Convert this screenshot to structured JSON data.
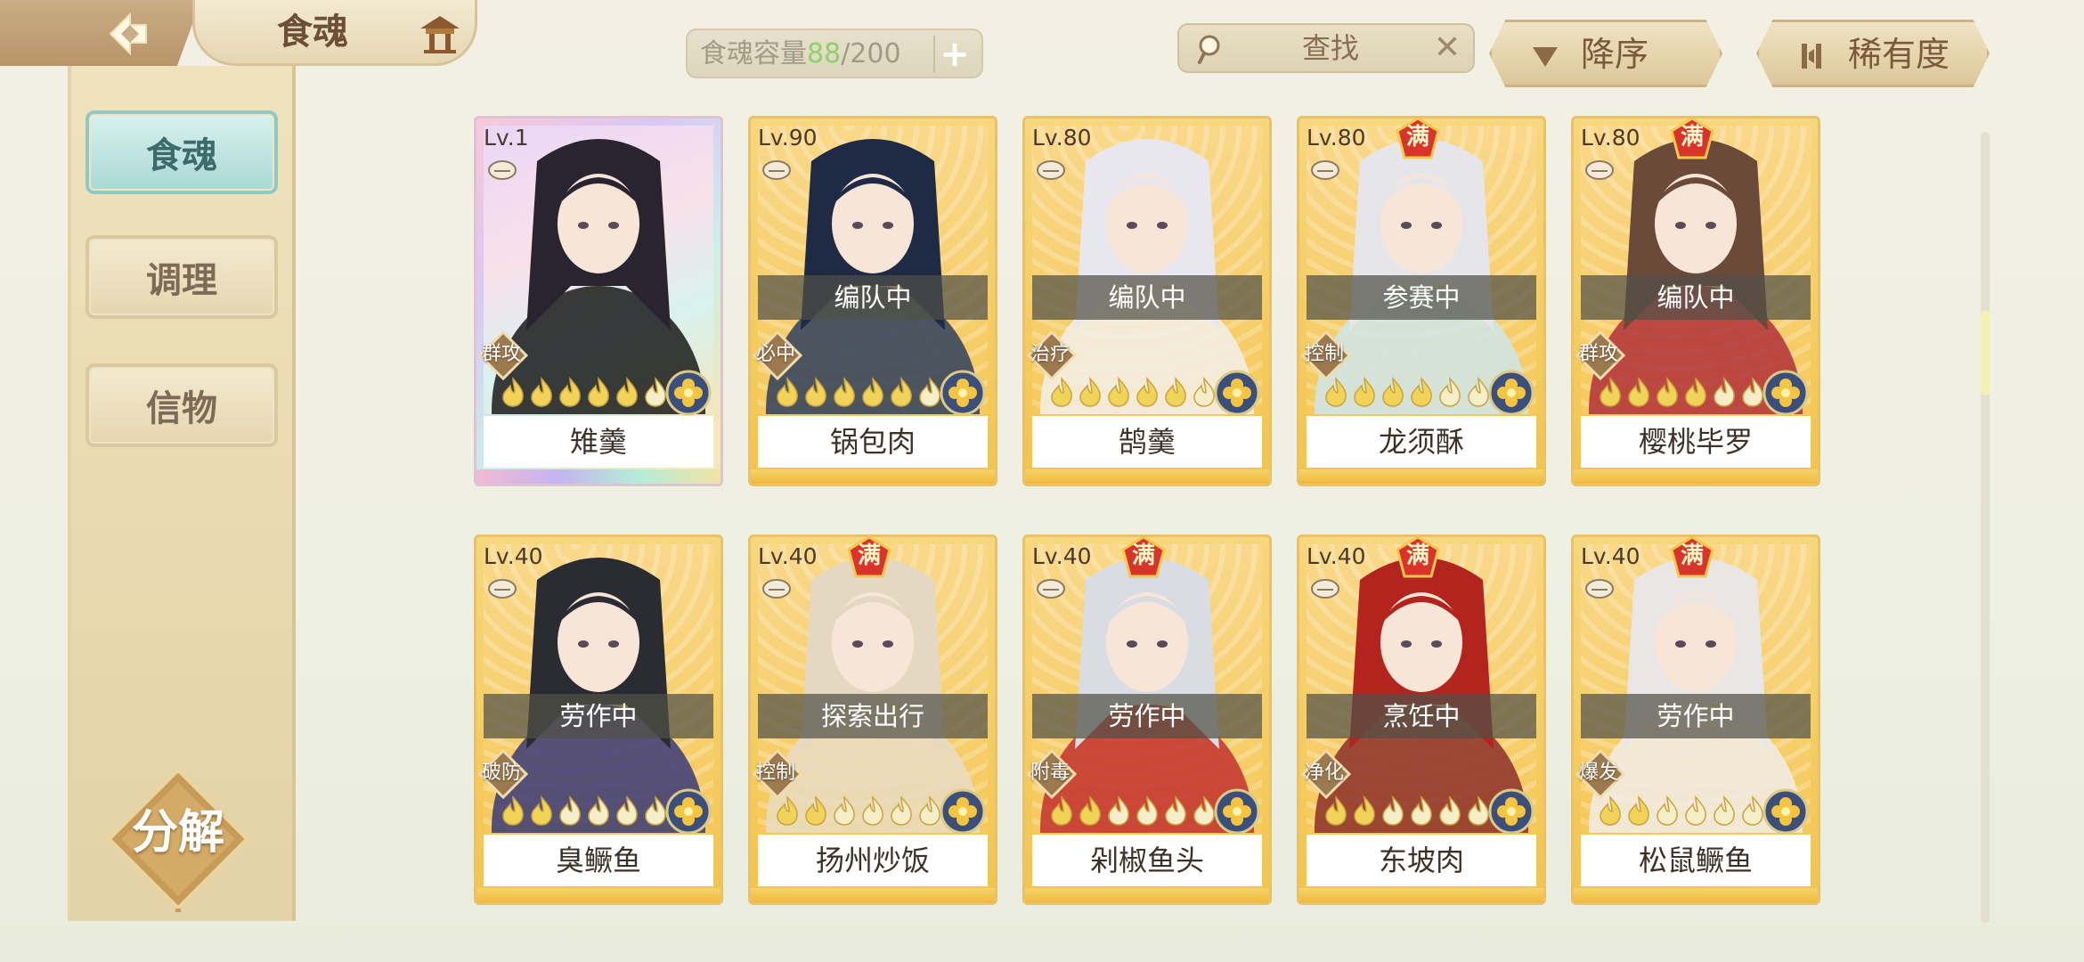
{
  "header": {
    "title": "食魂",
    "capacity": {
      "label": "食魂容量",
      "current": "88",
      "max": "/200",
      "add": "+"
    },
    "search": {
      "placeholder": "查找",
      "clear": "✕"
    },
    "sort_button": "降序",
    "rarity_button": "稀有度"
  },
  "sidebar": {
    "items": [
      {
        "label": "食魂",
        "active": true
      },
      {
        "label": "调理",
        "active": false
      },
      {
        "label": "信物",
        "active": false
      }
    ],
    "disassemble": "分解"
  },
  "cards": [
    {
      "level": "Lv.1",
      "name": "雉羹",
      "status": "",
      "role": "群攻",
      "full": "",
      "stars": 5,
      "rainbow": true
    },
    {
      "level": "Lv.90",
      "name": "锅包肉",
      "status": "编队中",
      "role": "必中",
      "full": "",
      "stars": 5
    },
    {
      "level": "Lv.80",
      "name": "鹄羹",
      "status": "编队中",
      "role": "治疗",
      "full": "",
      "stars": 5
    },
    {
      "level": "Lv.80",
      "name": "龙须酥",
      "status": "参赛中",
      "role": "控制",
      "full": "满",
      "stars": 4
    },
    {
      "level": "Lv.80",
      "name": "樱桃毕罗",
      "status": "编队中",
      "role": "群攻",
      "full": "满",
      "stars": 4
    },
    {
      "level": "Lv.40",
      "name": "臭鳜鱼",
      "status": "劳作中",
      "role": "破防",
      "full": "",
      "stars": 2
    },
    {
      "level": "Lv.40",
      "name": "扬州炒饭",
      "status": "探索出行",
      "role": "控制",
      "full": "满",
      "stars": 2
    },
    {
      "level": "Lv.40",
      "name": "剁椒鱼头",
      "status": "劳作中",
      "role": "附毒",
      "full": "满",
      "stars": 2
    },
    {
      "level": "Lv.40",
      "name": "东坡肉",
      "status": "烹饪中",
      "role": "净化",
      "full": "满",
      "stars": 2
    },
    {
      "level": "Lv.40",
      "name": "松鼠鳜鱼",
      "status": "劳作中",
      "role": "爆发",
      "full": "满",
      "stars": 2
    }
  ],
  "colors": {
    "accent_gold": "#f3c44a",
    "active_tab": "#a9d8d4",
    "capacity_current": "#8fcf6c",
    "panel_tan": "#e3d2a6"
  },
  "icons": {
    "back": "back-arrow-icon",
    "shop": "pavilion-icon",
    "search": "magnifier-icon",
    "sort": "triangle-down-icon",
    "rarity": "bars-icon",
    "bowl": "bowl-icon",
    "element": "flower-icon"
  }
}
